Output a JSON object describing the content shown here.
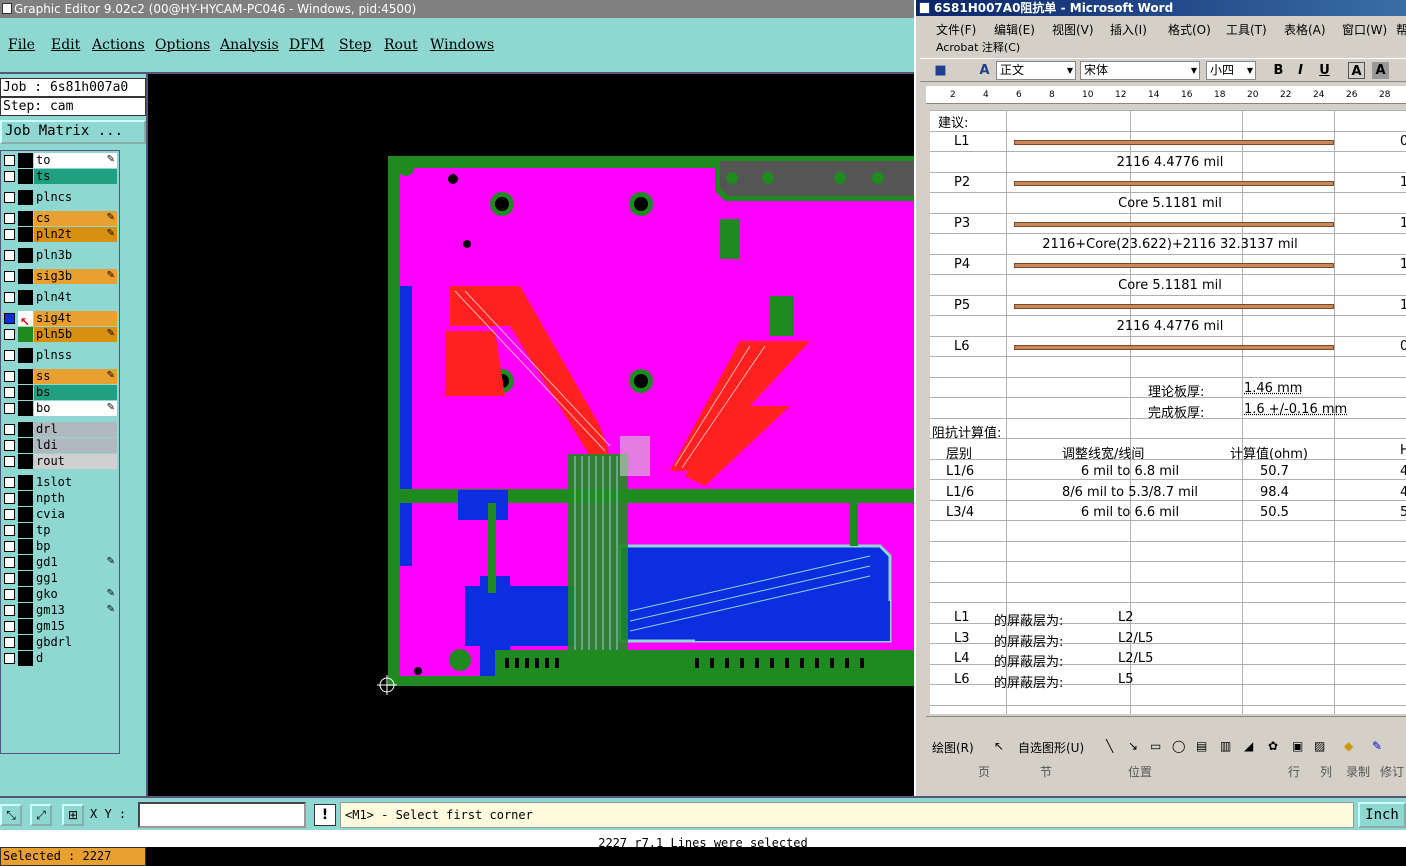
{
  "ge": {
    "title": "Graphic Editor 9.02c2 (00@HY-HYCAM-PC046 - Windows, pid:4500)",
    "menu": [
      "File",
      "Edit",
      "Actions",
      "Options",
      "Analysis",
      "DFM",
      "Step",
      "Rout",
      "Windows"
    ],
    "job": "Job : 6s81h007a0",
    "step": "Step: cam",
    "job_matrix": "Job Matrix ...",
    "layers": [
      {
        "name": "to",
        "color": "#ffffff",
        "pen": true
      },
      {
        "name": "ts",
        "color": "#1fa080",
        "pen": false
      },
      {
        "name": "plncs",
        "color": "#8fd8d2",
        "pen": false
      },
      {
        "name": "cs",
        "color": "#e8a030",
        "pen": true
      },
      {
        "name": "pln2t",
        "color": "#d89010",
        "pen": true
      },
      {
        "name": "pln3b",
        "color": "#8fd8d2",
        "pen": false
      },
      {
        "name": "sig3b",
        "color": "#e8a030",
        "pen": true
      },
      {
        "name": "pln4t",
        "color": "#8fd8d2",
        "pen": false
      },
      {
        "name": "sig4t",
        "color": "#e8a030",
        "pen": false
      },
      {
        "name": "pln5b",
        "color": "#d89010",
        "pen": true
      },
      {
        "name": "plnss",
        "color": "#8fd8d2",
        "pen": false
      },
      {
        "name": "ss",
        "color": "#e8a030",
        "pen": true
      },
      {
        "name": "bs",
        "color": "#1fa080",
        "pen": false
      },
      {
        "name": "bo",
        "color": "#ffffff",
        "pen": true
      },
      {
        "name": "drl",
        "color": "#b0b8c0",
        "pen": false
      },
      {
        "name": "ldi",
        "color": "#b0b8c0",
        "pen": false
      },
      {
        "name": "rout",
        "color": "#d0d0d0",
        "pen": false
      },
      {
        "name": "1slot",
        "color": "#8fd8d2",
        "pen": false
      },
      {
        "name": "npth",
        "color": "#8fd8d2",
        "pen": false
      },
      {
        "name": "cvia",
        "color": "#8fd8d2",
        "pen": false
      },
      {
        "name": "tp",
        "color": "#8fd8d2",
        "pen": false
      },
      {
        "name": "bp",
        "color": "#8fd8d2",
        "pen": false
      },
      {
        "name": "gd1",
        "color": "#8fd8d2",
        "pen": true
      },
      {
        "name": "gg1",
        "color": "#8fd8d2",
        "pen": false
      },
      {
        "name": "gko",
        "color": "#8fd8d2",
        "pen": true
      },
      {
        "name": "gm13",
        "color": "#8fd8d2",
        "pen": true
      },
      {
        "name": "gm15",
        "color": "#8fd8d2",
        "pen": false
      },
      {
        "name": "gbdrl",
        "color": "#8fd8d2",
        "pen": false
      },
      {
        "name": "d",
        "color": "#8fd8d2",
        "pen": false
      }
    ],
    "selected": "Selected : 2227",
    "xy_label": "X Y :",
    "prompt": "<M1> - Select first corner",
    "units": "Inch",
    "bottom_msg": "2227 r7.1 Lines were selected",
    "colors": {
      "panel": "#8fd8d2",
      "board": "#ff00ff",
      "copper": "#ff2020",
      "soldermask": "#1f8a1f",
      "plane": "#0a2ee0"
    }
  },
  "word": {
    "title": "6S81H007A0阻抗单 - Microsoft Word",
    "menu": [
      "文件(F)",
      "编辑(E)",
      "视图(V)",
      "插入(I)",
      "格式(O)",
      "工具(T)",
      "表格(A)",
      "窗口(W)",
      "帮"
    ],
    "acrobat": "Acrobat 注释(C)",
    "style": "正文",
    "font": "宋体",
    "size": "小四",
    "ruler": [
      "2",
      "4",
      "6",
      "8",
      "10",
      "12",
      "14",
      "16",
      "18",
      "20",
      "22",
      "24",
      "26",
      "28"
    ],
    "doc": {
      "suggest": "建议:",
      "stack": [
        {
          "label": "L1",
          "type": "copper",
          "right": "0"
        },
        {
          "label": "",
          "type": "text",
          "text": "2116    4.4776 mil"
        },
        {
          "label": "P2",
          "type": "copper",
          "right": "1"
        },
        {
          "label": "",
          "type": "text",
          "text": "Core   5.1181 mil"
        },
        {
          "label": "P3",
          "type": "copper",
          "right": "1"
        },
        {
          "label": "",
          "type": "text",
          "text": "2116+Core(23.622)+2116   32.3137 mil"
        },
        {
          "label": "P4",
          "type": "copper",
          "right": "1"
        },
        {
          "label": "",
          "type": "text",
          "text": "Core   5.1181 mil"
        },
        {
          "label": "P5",
          "type": "copper",
          "right": "1"
        },
        {
          "label": "",
          "type": "text",
          "text": "2116    4.4776 mil"
        },
        {
          "label": "L6",
          "type": "copper",
          "right": "0"
        }
      ],
      "theory_label": "理论板厚:",
      "theory_value": "1.46 mm",
      "finish_label": "完成板厚:",
      "finish_value": "1.6 +/-0.16 mm",
      "calc_title": "阻抗计算值:",
      "headers": [
        "层别",
        "调整线宽/线间",
        "计算值(ohm)",
        "H"
      ],
      "rows": [
        {
          "layer": "L1/6",
          "adjust": "6 mil to 6.8 mil",
          "value": "50.7",
          "r": "4"
        },
        {
          "layer": "L1/6",
          "adjust": "8/6 mil to 5.3/8.7 mil",
          "value": "98.4",
          "r": "4"
        },
        {
          "layer": "L3/4",
          "adjust": "6 mil to 6.6 mil",
          "value": "50.5",
          "r": "5"
        }
      ],
      "shield": [
        {
          "layer": "L1",
          "label": "的屏蔽层为:",
          "value": "L2"
        },
        {
          "layer": "L3",
          "label": "的屏蔽层为:",
          "value": "L2/L5"
        },
        {
          "layer": "L4",
          "label": "的屏蔽层为:",
          "value": "L2/L5"
        },
        {
          "layer": "L6",
          "label": "的屏蔽层为:",
          "value": "L5"
        }
      ]
    },
    "draw_toolbar": [
      "绘图(R)",
      "自选图形(U)"
    ],
    "status": [
      "页",
      "节",
      "位置",
      "行",
      "列",
      "录制",
      "修订"
    ]
  }
}
